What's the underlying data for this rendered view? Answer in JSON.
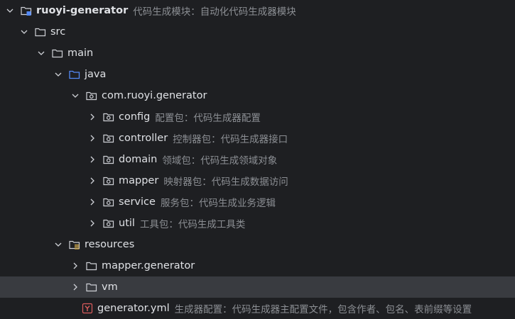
{
  "tree": {
    "root": {
      "name": "ruoyi-generator",
      "hint": "代码生成模块：自动化代码生成器模块"
    },
    "src": {
      "name": "src"
    },
    "main": {
      "name": "main"
    },
    "java": {
      "name": "java"
    },
    "package": {
      "name": "com.ruoyi.generator"
    },
    "packages": [
      {
        "name": "config",
        "hint": "配置包：代码生成器配置"
      },
      {
        "name": "controller",
        "hint": "控制器包：代码生成器接口"
      },
      {
        "name": "domain",
        "hint": "领域包：代码生成领域对象"
      },
      {
        "name": "mapper",
        "hint": "映射器包：代码生成数据访问"
      },
      {
        "name": "service",
        "hint": "服务包：代码生成业务逻辑"
      },
      {
        "name": "util",
        "hint": "工具包：代码生成工具类"
      }
    ],
    "resources": {
      "name": "resources"
    },
    "mapper_generator": {
      "name": "mapper.generator"
    },
    "vm": {
      "name": "vm"
    },
    "generator_yml": {
      "name": "generator.yml",
      "hint": "生成器配置：代码生成器主配置文件，包含作者、包名、表前缀等设置"
    }
  },
  "icons": {
    "module": "module-folder-icon",
    "folder": "folder-icon",
    "source_root": "source-root-folder-icon",
    "package": "package-icon",
    "resources_root": "resources-root-folder-icon",
    "yaml_file": "yaml-file-icon",
    "chevron_down": "chevron-down-icon",
    "chevron_right": "chevron-right-icon"
  },
  "colors": {
    "background": "#1e1f22",
    "selection": "#393b40",
    "text": "#dfe1e5",
    "hint": "#8c8f94",
    "source_root_blue": "#548af7",
    "yaml_red": "#db5c5c"
  }
}
